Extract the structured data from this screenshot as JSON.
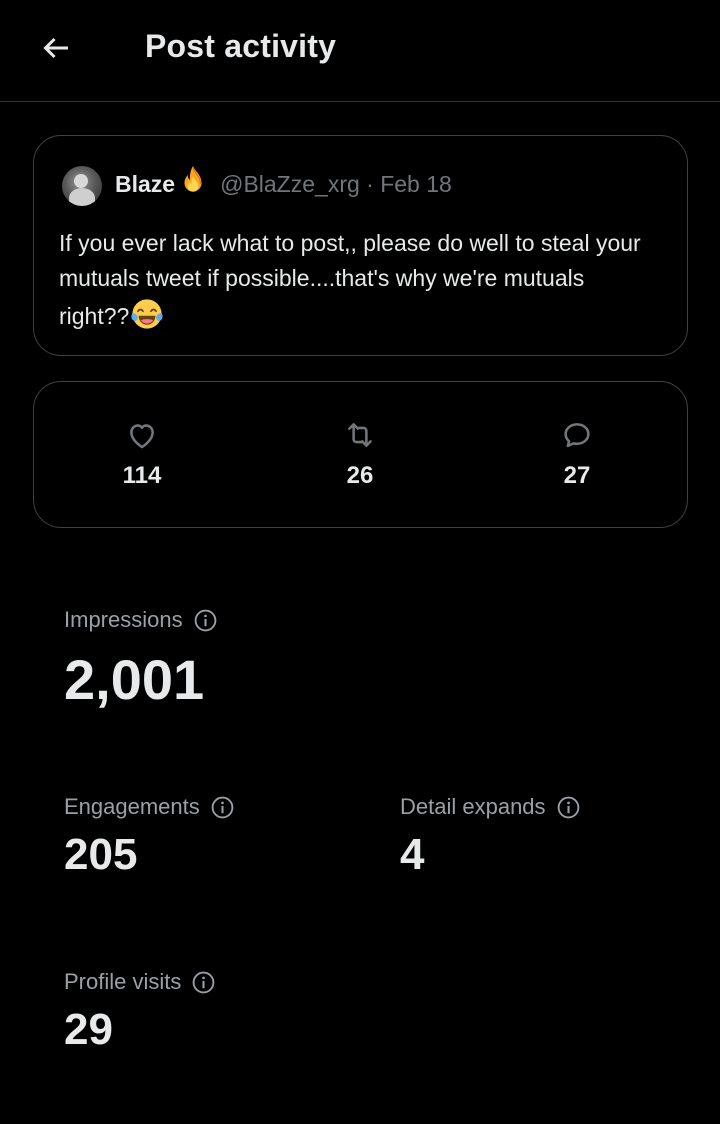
{
  "header": {
    "title": "Post activity",
    "back_icon": "arrow-left-icon"
  },
  "post": {
    "author_name": "Blaze",
    "author_badge_icon": "fire-emoji-icon",
    "handle_date": "@BlaZze_xrg · Feb 18",
    "text": "If you ever lack what to post,, please do well to steal your mutuals tweet if possible....that's why we're mutuals right??",
    "trailing_emoji_icon": "tears-of-joy-emoji-icon"
  },
  "engagement_bar": {
    "likes": "114",
    "reposts": "26",
    "replies": "27",
    "like_icon": "heart-icon",
    "repost_icon": "repost-icon",
    "reply_icon": "reply-bubble-icon"
  },
  "metrics": {
    "impressions": {
      "label": "Impressions",
      "value": "2,001"
    },
    "engagements": {
      "label": "Engagements",
      "value": "205"
    },
    "detail_expands": {
      "label": "Detail expands",
      "value": "4"
    },
    "profile_visits": {
      "label": "Profile visits",
      "value": "29"
    },
    "info_icon": "info-circle-icon"
  },
  "colors": {
    "background": "#000000",
    "text_primary": "#e7e9ea",
    "text_secondary": "#71767b",
    "border": "#2f3336"
  }
}
